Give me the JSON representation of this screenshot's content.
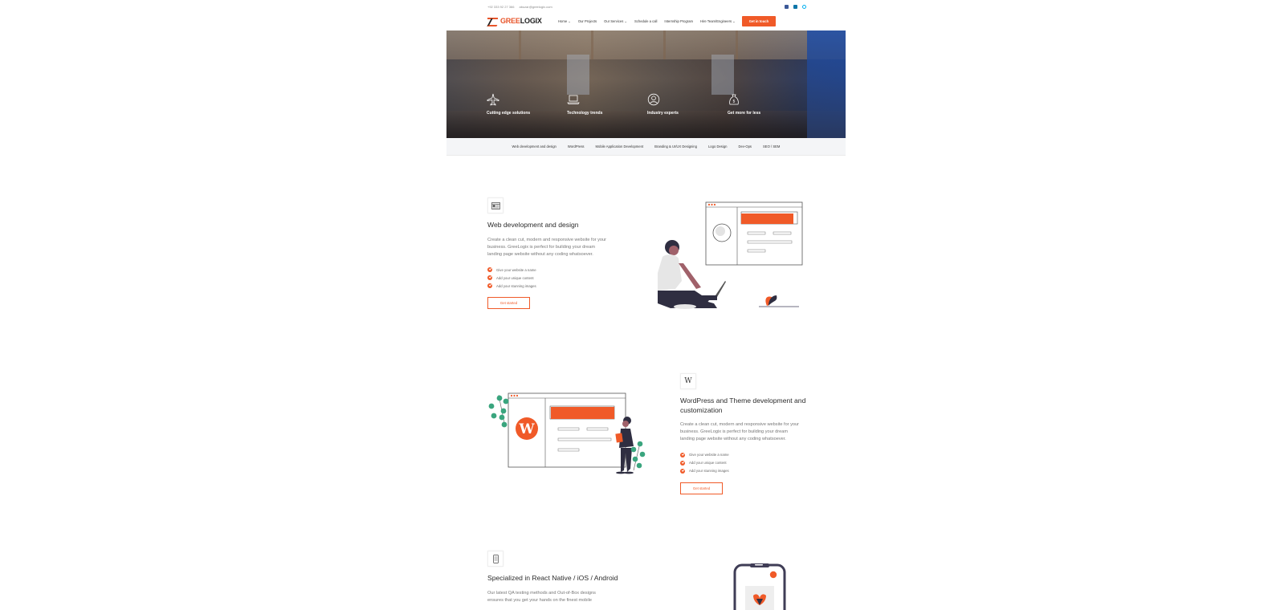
{
  "topbar": {
    "phone": "+92 333 92 27 366",
    "email": "abuzar@greelogix.com",
    "social": [
      "facebook-icon",
      "linkedin-icon",
      "skype-icon"
    ]
  },
  "nav": {
    "logo_a": "GREE",
    "logo_b": "LOGIX",
    "items": [
      "Home ⌄",
      "Our Projects",
      "Our Services ⌄",
      "Schedule a call",
      "Internship Program",
      "Hire Team/Engineers ⌄"
    ],
    "cta": "Get in touch"
  },
  "hero": {
    "features": [
      {
        "icon": "airplane-icon",
        "label": "Cutting edge solutions"
      },
      {
        "icon": "laptop-icon",
        "label": "Technology trends"
      },
      {
        "icon": "user-circle-icon",
        "label": "Industry experts"
      },
      {
        "icon": "money-bag-icon",
        "label": "Get more for less"
      }
    ]
  },
  "tabs": [
    "Web development and design",
    "WordPress",
    "Mobile Application Development",
    "Branding & UI/UX Designing",
    "Logo Design",
    "Dev-Ops",
    "SEO / SEM"
  ],
  "sections": [
    {
      "icon": "browser-layout-icon",
      "title": "Web development and design",
      "desc": "Create a clean cut, modern and responsive website for your business. GreeLogix is perfect for building your dream landing page website without any coding whatsoever.",
      "checks": [
        "Give your website a name",
        "Add your unique content",
        "Add your stunning images"
      ],
      "button": "Get started"
    },
    {
      "icon": "wordpress-icon",
      "icon_glyph": "W",
      "title": "WordPress and Theme development and customization",
      "desc": "Create a clean cut, modern and responsive website for your business. GreeLogix is perfect for building your dream landing page website without any coding whatsoever.",
      "checks": [
        "Give your website a name",
        "Add your unique content",
        "Add your stunning images"
      ],
      "button": "Get started"
    },
    {
      "icon": "mobile-phone-icon",
      "title": "Specialized in React Native / iOS / Android",
      "desc": "Our latest QA testing methods and Out-of-Box designs ensures that you get your hands on the finest mobile"
    }
  ],
  "colors": {
    "accent": "#f05a28",
    "text": "#2c2c2c",
    "muted": "#777777",
    "wp_blue": "#21759b"
  }
}
